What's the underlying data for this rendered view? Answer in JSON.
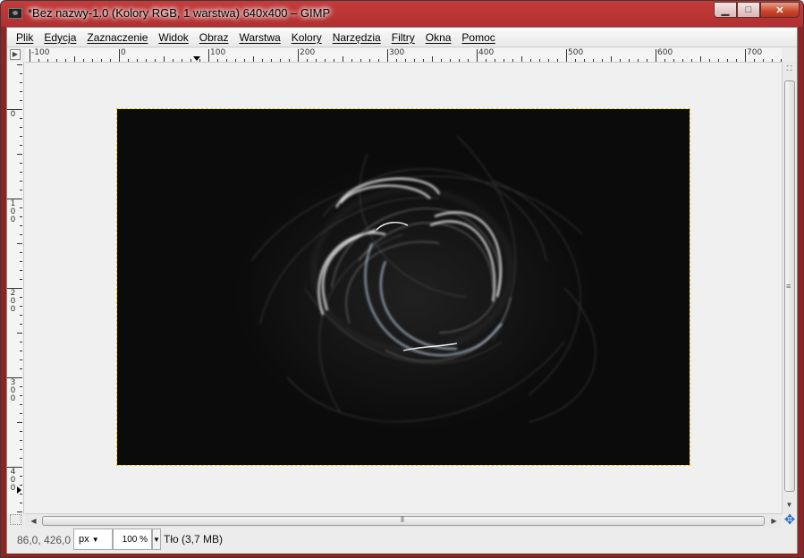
{
  "window": {
    "title": "*Bez nazwy-1.0 (Kolory RGB, 1 warstwa) 640x400 – GIMP",
    "minimize_glyph": "▁",
    "maximize_glyph": "□",
    "close_glyph": "✕"
  },
  "menu": [
    "Plik",
    "Edycja",
    "Zaznaczenie",
    "Widok",
    "Obraz",
    "Warstwa",
    "Kolory",
    "Narzędzia",
    "Filtry",
    "Okna",
    "Pomoc"
  ],
  "rulers": {
    "horizontal_labels": [
      "-100",
      "0",
      "100",
      "200",
      "300",
      "400",
      "500",
      "600",
      "700"
    ],
    "vertical_labels": [
      "0",
      "100",
      "200",
      "300",
      "400"
    ],
    "corner_glyph": "▶"
  },
  "image": {
    "description_colors": {
      "background": "#0b0b0b",
      "strands": "#ffffff",
      "accent": "#a9c6e8",
      "selection_border": "#f0d000"
    }
  },
  "status": {
    "coordinates": "86,0, 426,0",
    "unit": "px",
    "zoom": "100 %",
    "layer": "Tło (3,7 MB)"
  },
  "icons": {
    "navigate": "navigate-icon",
    "quick_mask": "quick-mask-icon"
  }
}
